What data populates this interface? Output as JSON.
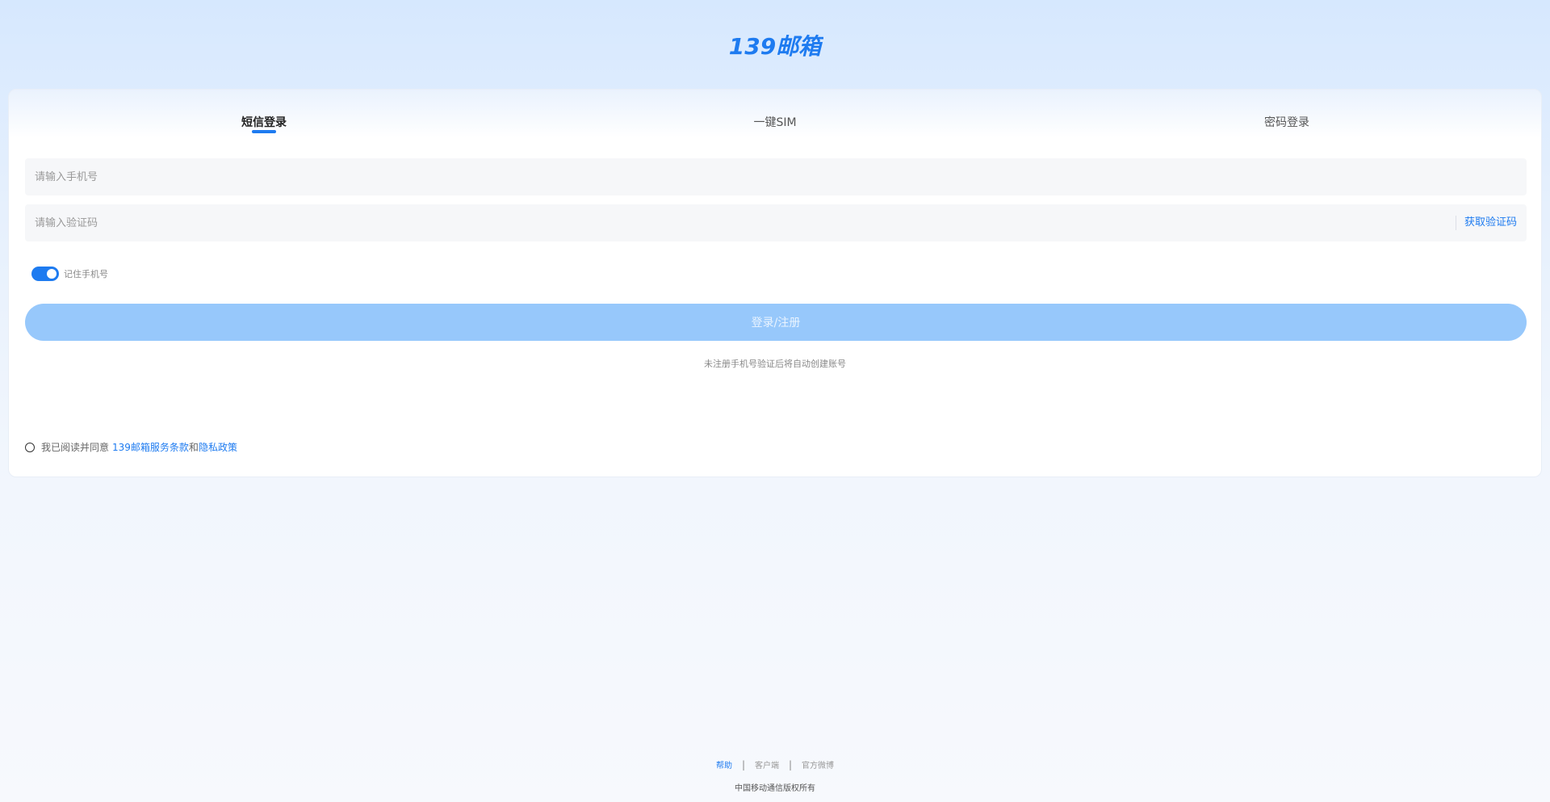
{
  "logo": {
    "text": "139邮箱",
    "color": "#1e7bf0"
  },
  "tabs": [
    {
      "label": "短信登录",
      "active": true
    },
    {
      "label": "一键SIM",
      "active": false
    },
    {
      "label": "密码登录",
      "active": false
    }
  ],
  "form": {
    "phone_placeholder": "请输入手机号",
    "code_placeholder": "请输入验证码",
    "get_code_label": "获取验证码",
    "remember_label": "记住手机号",
    "remember_on": true,
    "submit_label": "登录/注册",
    "hint_text": "未注册手机号验证后将自动创建账号"
  },
  "agreement": {
    "prefix": "我已阅读并同意",
    "link_text": "139邮箱服务条款",
    "separator": "和",
    "link2_text": "隐私政策",
    "checked": false
  },
  "footer": {
    "links": [
      "帮助",
      "客户端",
      "官方微博"
    ],
    "copyright": "中国移动通信版权所有"
  },
  "colors": {
    "accent": "#1e7bf0",
    "button_disabled": "#97c8fb"
  }
}
